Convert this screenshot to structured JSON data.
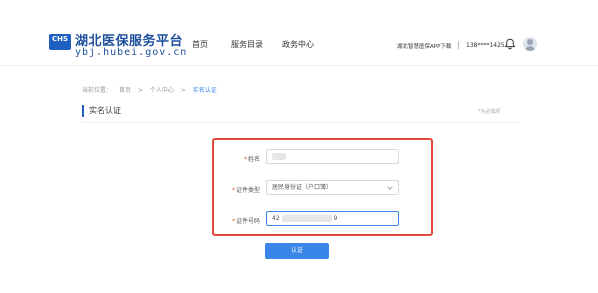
{
  "header": {
    "logo_text": "CHS",
    "site_title": "湖北医保服务平台",
    "site_url": "ybj.hubei.gov.cn",
    "nav": [
      {
        "label": "首页"
      },
      {
        "label": "服务目录"
      },
      {
        "label": "政务中心"
      }
    ],
    "app_link": "湖北智慧医保APP下载",
    "phone": "138****1425",
    "icons": {
      "bell": "bell-icon",
      "avatar": "user-avatar"
    }
  },
  "breadcrumb": {
    "prefix": "当前位置：",
    "items": [
      "首页",
      ">",
      "个人中心",
      ">",
      "实名认证"
    ]
  },
  "page": {
    "title": "实名认证",
    "hint": "*为必填项"
  },
  "form": {
    "fields": [
      {
        "required": "*",
        "label": "姓名",
        "value": ""
      },
      {
        "required": "*",
        "label": "证件类型",
        "value": "居民身份证（户口簿）"
      },
      {
        "required": "*",
        "label": "证件号码",
        "value_prefix": "42",
        "value_suffix": "9"
      }
    ],
    "submit_label": "认证"
  },
  "colors": {
    "brand": "#1e4f9c",
    "accent": "#3a86e8",
    "highlight": "#e24a3b"
  }
}
